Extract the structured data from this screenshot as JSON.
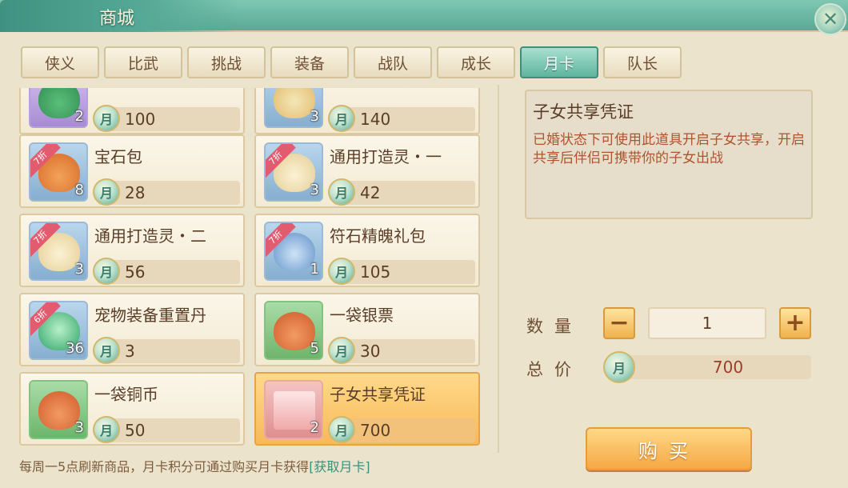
{
  "window": {
    "title": "商城"
  },
  "tabs": [
    {
      "label": "侠义"
    },
    {
      "label": "比武"
    },
    {
      "label": "挑战"
    },
    {
      "label": "装备"
    },
    {
      "label": "战队"
    },
    {
      "label": "成长"
    },
    {
      "label": "月卡",
      "active": true
    },
    {
      "label": "队长"
    }
  ],
  "currency_symbol": "月",
  "items": [
    {
      "name": "",
      "qty": "2",
      "price": "100",
      "discount": ""
    },
    {
      "name": "",
      "qty": "3",
      "price": "140",
      "discount": ""
    },
    {
      "name": "宝石包",
      "qty": "8",
      "price": "28",
      "discount": "7折"
    },
    {
      "name": "通用打造灵・一",
      "qty": "3",
      "price": "42",
      "discount": "7折"
    },
    {
      "name": "通用打造灵・二",
      "qty": "3",
      "price": "56",
      "discount": "7折"
    },
    {
      "name": "符石精魄礼包",
      "qty": "1",
      "price": "105",
      "discount": "7折"
    },
    {
      "name": "宠物装备重置丹",
      "qty": "36",
      "price": "3",
      "discount": "6折"
    },
    {
      "name": "一袋银票",
      "qty": "5",
      "price": "30",
      "discount": ""
    },
    {
      "name": "一袋铜币",
      "qty": "3",
      "price": "50",
      "discount": ""
    },
    {
      "name": "子女共享凭证",
      "qty": "2",
      "price": "700",
      "discount": "",
      "selected": true
    }
  ],
  "detail": {
    "title": "子女共享凭证",
    "description": "已婚状态下可使用此道具开启子女共享，开启共享后伴侣可携带你的子女出战"
  },
  "purchase": {
    "quantity_label": "数量",
    "quantity": "1",
    "minus": "−",
    "plus": "+",
    "total_label": "总价",
    "total": "700",
    "buy_label": "购买"
  },
  "footer": {
    "note": "每周一5点刷新商品，月卡积分可通过购买月卡获得",
    "link": "[获取月卡]"
  },
  "close_icon": "close-icon",
  "colors": {
    "accent_green": "#5fb49e",
    "selected_orange": "#f7b95a",
    "desc_red": "#b0542f"
  }
}
